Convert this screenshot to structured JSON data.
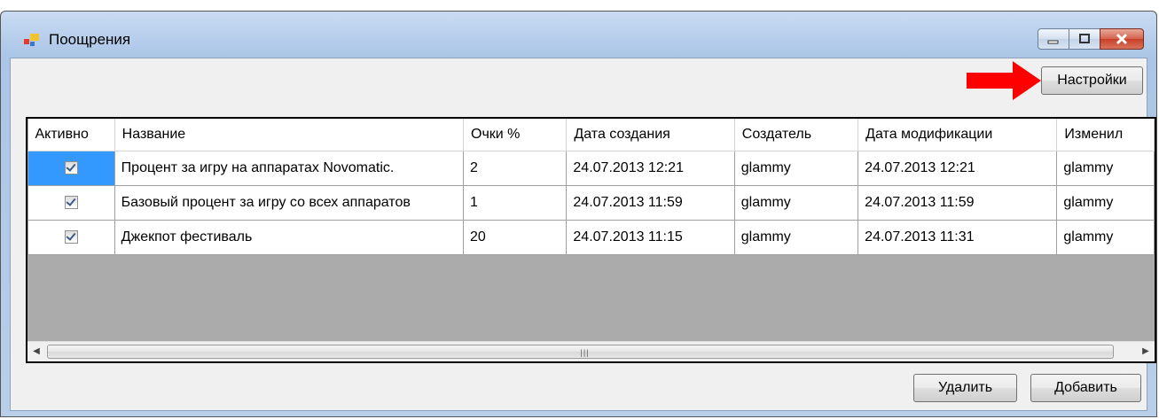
{
  "window": {
    "title": "Поощрения",
    "controls": {
      "minimize_icon": "minimize-icon",
      "maximize_icon": "maximize-icon",
      "close_icon": "close-icon"
    }
  },
  "toolbar": {
    "settings_label": "Настройки"
  },
  "grid": {
    "columns": [
      "Активно",
      "Название",
      "Очки %",
      "Дата создания",
      "Создатель",
      "Дата модификации",
      "Изменил"
    ],
    "rows": [
      {
        "active": true,
        "name": "Процент за игру на аппаратах Novomatic.",
        "points": "2",
        "created": "24.07.2013 12:21",
        "creator": "glammy",
        "modified": "24.07.2013 12:21",
        "modifier": "glammy"
      },
      {
        "active": true,
        "name": "Базовый процент за игру со всех аппаратов",
        "points": "1",
        "created": "24.07.2013 11:59",
        "creator": "glammy",
        "modified": "24.07.2013 11:59",
        "modifier": "glammy"
      },
      {
        "active": true,
        "name": "Джекпот фестиваль",
        "points": "20",
        "created": "24.07.2013 11:15",
        "creator": "glammy",
        "modified": "24.07.2013 11:31",
        "modifier": "glammy"
      }
    ]
  },
  "footer": {
    "delete_label": "Удалить",
    "add_label": "Добавить"
  },
  "colors": {
    "selection": "#3399ff",
    "annotation_arrow": "#ff0000",
    "grid_background": "#ababab"
  }
}
